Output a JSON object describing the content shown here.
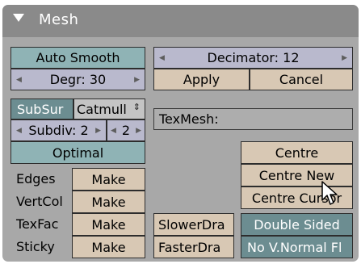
{
  "panel": {
    "title": "Mesh"
  },
  "left": {
    "auto_smooth": "Auto Smooth",
    "degr": "Degr: 30",
    "subsurf": "SubSur",
    "catmull": "Catmull",
    "subdiv": "Subdiv: 2",
    "subdiv_render": "2",
    "optimal": "Optimal"
  },
  "make_rows": [
    {
      "label": "Edges",
      "button": "Make"
    },
    {
      "label": "VertCol",
      "button": "Make"
    },
    {
      "label": "TexFac",
      "button": "Make"
    },
    {
      "label": "Sticky",
      "button": "Make"
    }
  ],
  "right": {
    "decimator": "Decimator: 12",
    "apply": "Apply",
    "cancel": "Cancel",
    "texmesh": "TexMesh:",
    "centre": "Centre",
    "centre_new": "Centre New",
    "centre_cursor": "Centre Cursor",
    "slower": "SlowerDra",
    "faster": "FasterDra",
    "double_sided": "Double Sided",
    "no_vnormal": "No V.Normal Fl"
  }
}
